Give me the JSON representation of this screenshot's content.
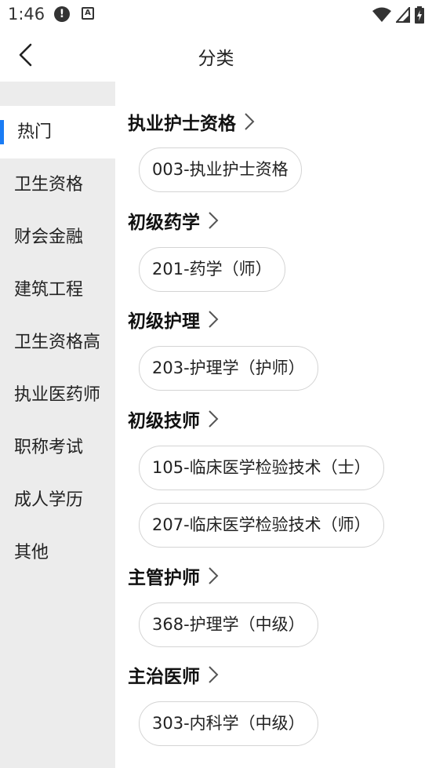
{
  "status_bar": {
    "time": "1:46",
    "alert_glyph": "!",
    "a_glyph": "A"
  },
  "header": {
    "title": "分类"
  },
  "sidebar": {
    "items": [
      {
        "label": "热门"
      },
      {
        "label": "卫生资格"
      },
      {
        "label": "财会金融"
      },
      {
        "label": "建筑工程"
      },
      {
        "label": "卫生资格高"
      },
      {
        "label": "执业医药师"
      },
      {
        "label": "职称考试"
      },
      {
        "label": "成人学历"
      },
      {
        "label": "其他"
      }
    ]
  },
  "sections": [
    {
      "title": "执业护士资格",
      "chips": [
        "003-执业护士资格"
      ]
    },
    {
      "title": "初级药学",
      "chips": [
        "201-药学（师）"
      ]
    },
    {
      "title": "初级护理",
      "chips": [
        "203-护理学（护师）"
      ]
    },
    {
      "title": "初级技师",
      "chips": [
        "105-临床医学检验技术（士）",
        "207-临床医学检验技术（师）"
      ]
    },
    {
      "title": "主管护师",
      "chips": [
        "368-护理学（中级）"
      ]
    },
    {
      "title": "主治医师",
      "chips": [
        "303-内科学（中级）"
      ]
    }
  ],
  "colors": {
    "accent": "#1a7cf5",
    "sidebar_bg": "#ececec",
    "chip_border": "#d4d4d4"
  },
  "icons": {
    "back": "chevron-left-icon",
    "section_arrow": "chevron-right-icon",
    "wifi": "wifi-icon",
    "signal": "signal-icon",
    "battery": "battery-icon"
  }
}
